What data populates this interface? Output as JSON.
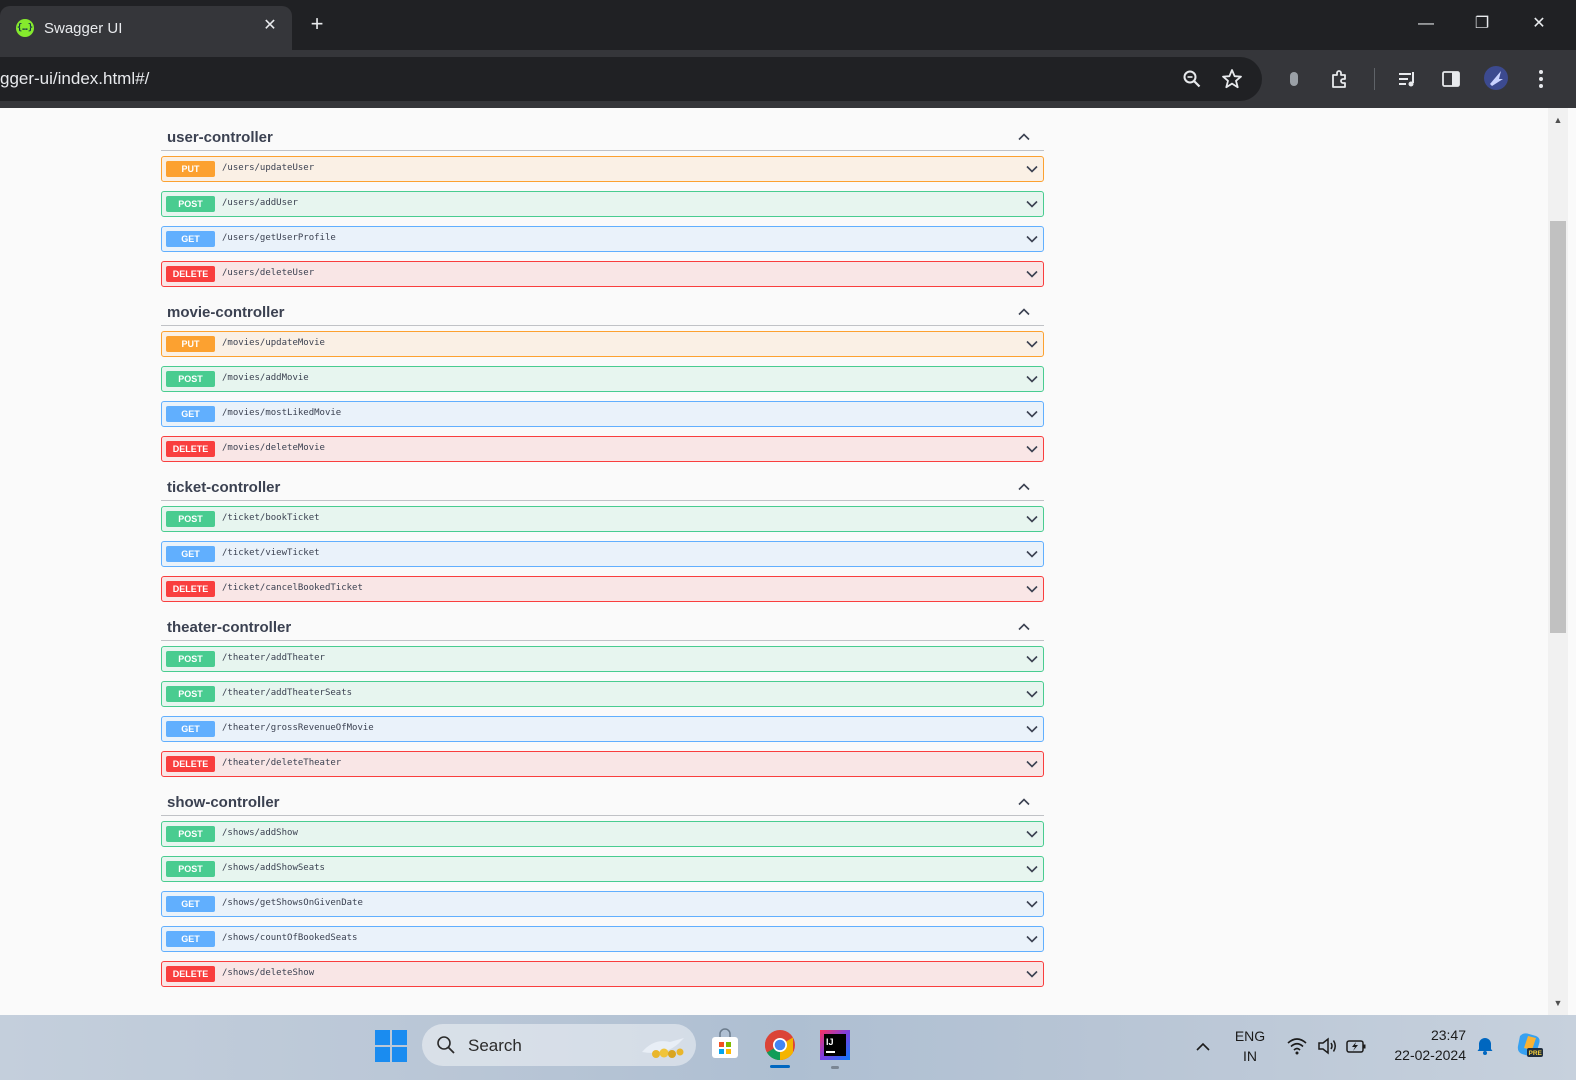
{
  "browser": {
    "tab_title": "Swagger UI",
    "tab_close": "✕",
    "new_tab": "+",
    "url": "gger-ui/index.html#/",
    "window_controls": {
      "minimize": "—",
      "restore": "❐",
      "close": "✕"
    }
  },
  "sections": [
    {
      "title": "user-controller",
      "operations": [
        {
          "method": "PUT",
          "path": "/users/updateUser"
        },
        {
          "method": "POST",
          "path": "/users/addUser"
        },
        {
          "method": "GET",
          "path": "/users/getUserProfile"
        },
        {
          "method": "DELETE",
          "path": "/users/deleteUser"
        }
      ]
    },
    {
      "title": "movie-controller",
      "operations": [
        {
          "method": "PUT",
          "path": "/movies/updateMovie"
        },
        {
          "method": "POST",
          "path": "/movies/addMovie"
        },
        {
          "method": "GET",
          "path": "/movies/mostLikedMovie"
        },
        {
          "method": "DELETE",
          "path": "/movies/deleteMovie"
        }
      ]
    },
    {
      "title": "ticket-controller",
      "operations": [
        {
          "method": "POST",
          "path": "/ticket/bookTicket"
        },
        {
          "method": "GET",
          "path": "/ticket/viewTicket"
        },
        {
          "method": "DELETE",
          "path": "/ticket/cancelBookedTicket"
        }
      ]
    },
    {
      "title": "theater-controller",
      "operations": [
        {
          "method": "POST",
          "path": "/theater/addTheater"
        },
        {
          "method": "POST",
          "path": "/theater/addTheaterSeats"
        },
        {
          "method": "GET",
          "path": "/theater/grossRevenueOfMovie"
        },
        {
          "method": "DELETE",
          "path": "/theater/deleteTheater"
        }
      ]
    },
    {
      "title": "show-controller",
      "operations": [
        {
          "method": "POST",
          "path": "/shows/addShow"
        },
        {
          "method": "POST",
          "path": "/shows/addShowSeats"
        },
        {
          "method": "GET",
          "path": "/shows/getShowsOnGivenDate"
        },
        {
          "method": "GET",
          "path": "/shows/countOfBookedSeats"
        },
        {
          "method": "DELETE",
          "path": "/shows/deleteShow"
        }
      ]
    }
  ],
  "taskbar": {
    "search_placeholder": "Search",
    "lang_top": "ENG",
    "lang_bottom": "IN",
    "time": "23:47",
    "date": "22-02-2024"
  },
  "colors": {
    "put": "#fca130",
    "post": "#49cc90",
    "get": "#61affe",
    "delete": "#f93e3e"
  }
}
